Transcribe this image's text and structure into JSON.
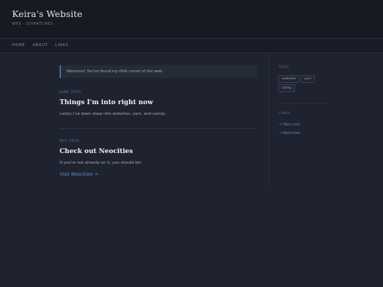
{
  "header": {
    "title": "Keira's Website",
    "subtitle": "WPS · DISPATCHES"
  },
  "nav": {
    "items": [
      {
        "label": "HOME"
      },
      {
        "label": "ABOUT"
      },
      {
        "label": "LINKS"
      }
    ]
  },
  "main": {
    "welcome": "Welcome! You've found my little corner of the web.",
    "posts": [
      {
        "date": "JUNE 2026",
        "title": "Things I'm into right now",
        "body": "Lately I've been deep into websites, yarn, and catnip."
      },
      {
        "date": "MAY 2026",
        "title": "Check out Neocities",
        "body": "If you're not already on it, you should be!",
        "link": "Visit Neocities →"
      }
    ]
  },
  "sidebar": {
    "tags_heading": "TAGS",
    "tags": [
      "websites",
      "yarn",
      "catnip"
    ],
    "links_heading": "LINKS",
    "links": [
      "→ Yarn.com",
      "→ Neocities"
    ]
  }
}
